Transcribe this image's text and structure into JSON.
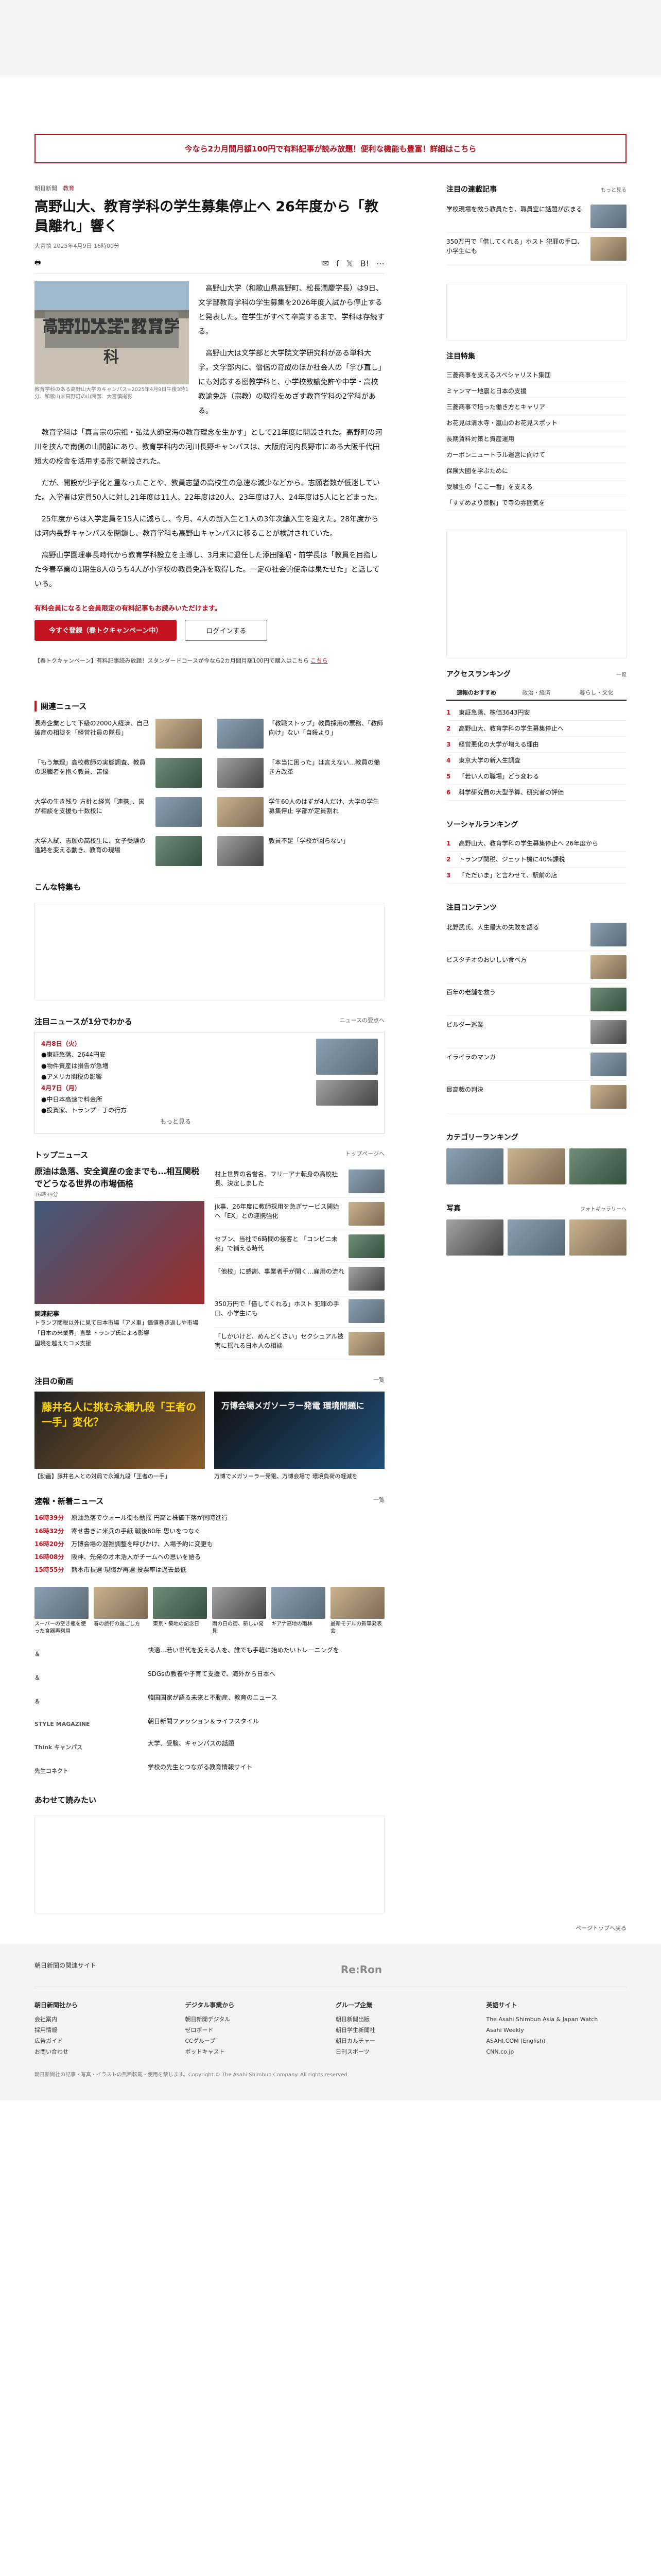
{
  "promo": "今なら2カ月間月額100円で有料記事が読み放題！便利な機能も豊富！詳細はこちら",
  "article": {
    "crumb_section": "朝日新聞",
    "crumb_category": "教育",
    "title": "高野山大、教育学科の学生募集停止へ 26年度から「教員離れ」響く",
    "byline": "大宮慎 2025年4月9日 16時00分",
    "photo_sign": "高野山大学 教育学科",
    "caption": "教育学科のある高野山大学のキャンパス=2025年4月9日午後3時1分、和歌山県高野町の山間部、大宮慎撮影",
    "paragraphs": [
      "高野山大学（和歌山県高野町、松長潤慶学長）は9日、文学部教育学科の学生募集を2026年度入試から停止すると発表した。在学生がすべて卒業するまで、学科は存続する。",
      "高野山大は文学部と大学院文学研究科がある単科大学。文学部内に、僧侶の育成のほか社会人の「学び直し」にも対応する密教学科と、小学校教諭免許や中学・高校教諭免許（宗教）の取得をめざす教育学科の2学科がある。",
      "教育学科は「真言宗の宗祖・弘法大師空海の教育理念を生かす」として21年度に開設された。高野町の河川を挟んで南側の山間部にあり、教育学科内の河川長野キャンパスは、大阪府河内長野市にある大阪千代田短大の校舎を活用する形で新設された。",
      "だが、開設が少子化と重なったことや、教員志望の高校生の急速な減少などから、志願者数が低迷していた。入学者は定員50人に対し21年度は11人、22年度は20人、23年度は7人、24年度は5人にとどまった。",
      "25年度からは入学定員を15人に減らし、今月、4人の新入生と1人の3年次編入生を迎えた。28年度からは河内長野キャンパスを閉鎖し、教育学科も高野山キャンパスに移ることが検討されていた。",
      "高野山学園理事長時代から教育学科設立を主導し、3月末に退任した添田隆昭・前学長は「教員を目指した今春卒業の1期生8人のうち4人が小学校の教員免許を取得した。一定の社会的使命は果たせた」と話している。"
    ],
    "members_note": "有料会員になると会員限定の有料記事もお読みいただけます。",
    "btn_subscribe": "今すぐ登録（春トクキャンペーン中）",
    "btn_login": "ログインする",
    "campaign_text": "【春トクキャンペーン】有料記事読み放題！スタンダードコースが今なら2カ月間月額100円で購入はこちら",
    "campaign_link": "こちら"
  },
  "related": {
    "heading": "関連ニュース",
    "items": [
      "長寿企業として下級の2000人経済、自己破産の相談を「経営社員の隊長」",
      "「教職ストップ」教員採用の票務、「教師向け」ない「自殺より」",
      "「もう無理」高校教師の実態調査、教員の退職者を抱く教員、苦悩",
      "「本当に困った」は言えない…教員の働き方改革",
      "大学の生き残り 方針と経営「連携」、国が相談を支援も十数校に",
      "学生60人のはずが4人だけ、大学の学生募集停止 学部が定員割れ",
      "大学入試、志願の高校生に、女子受験の進路を変える動き、教育の現場",
      "教員不足「学校が回らない」"
    ]
  },
  "special": {
    "heading": "こんな特集も"
  },
  "calendar": {
    "heading": "注目ニュースが1分でわかる",
    "link": "ニュースの要点へ",
    "day1": "4月8日（火）",
    "day1_items": [
      "●東証急落、2644円安",
      "●物件資産は損告が急増",
      "●アメリカ関税の影響"
    ],
    "day2": "4月7日（月）",
    "day2_items": [
      "●中日本高速で料金所",
      "●投資家、トランプ一丁の行方"
    ],
    "more": "もっと見る"
  },
  "topnews": {
    "heading": "トップニュース",
    "link": "トップページへ",
    "lead_title": "原油は急落、安全資産の金までも…相互関税でどうなる世界の市場価格",
    "lead_time": "16時39分",
    "sub_title": "関連記事",
    "sub_items": [
      "トランプ関税以外に見て日本市場「アメ車」価値巻き返しや市場",
      "「日本の米業界」直撃 トランプ氏による影響",
      "国境を越えたコメ支援"
    ],
    "items": [
      "村上世界の名誉名、フリーアナ転身の高校社長、決定しました",
      "jk事、26年度に教師採用を急ぎサービス開始へ「EX」との連携強化",
      "セブン、当社で6時間の接客と 「コンビニ未来」で補える時代",
      "「他校」に感謝、事業者手が開く…雇用の流れ",
      "350万円で「借してくれる」ホスト 犯罪の手口、小学生にも",
      "「しかいけど、めんどくさい」セクシュアル被害に揺れる日本人の相談"
    ]
  },
  "video": {
    "heading": "注目の動画",
    "link": "一覧",
    "v1": "藤井名人に挑む永瀬九段「王者の一手」変化？",
    "v2": "万博会場メガソーラー発電 環境問題に",
    "cap1": "【動画】藤井名人との対局で永瀬九段「王者の一手」",
    "cap2": "万博でメガソーラー発電、万博会場で 環境負荷の軽減を"
  },
  "flash": {
    "heading": "速報・新着ニュース",
    "link": "一覧",
    "items": [
      {
        "t": "16時39分",
        "s": "原油急落でウォール街も動揺 円高と株価下落が同時進行"
      },
      {
        "t": "16時32分",
        "s": "寄せ書きに米兵の手紙 戦後80年 思いをつなぐ"
      },
      {
        "t": "16時20分",
        "s": "万博会場の混雑調整を呼びかけ、入場予約に変更も"
      },
      {
        "t": "16時08分",
        "s": "阪神、先発の才木浩人がチームへの思いを語る"
      },
      {
        "t": "15時55分",
        "s": "熊本市長選 現職が再選 投票率は過去最低"
      }
    ]
  },
  "pictures": [
    "スーパーの空き瓶を使った食器再利用",
    "春の旅行の過ごし方",
    "東京・築地の記念日",
    "雨の日の街、新しい発見",
    "ギアナ高地の雨林",
    "最新モデルの新車発表会"
  ],
  "brands": [
    {
      "logo": "＆",
      "txt": "快適…若い世代を変える人を、誰でも手軽に始めたいトレーニングを"
    },
    {
      "logo": "＆",
      "txt": "SDGsの教養や子育て支援で、海外から日本へ"
    },
    {
      "logo": "＆",
      "txt": "韓国国家が語る未来と不動産、教育のニュース"
    },
    {
      "logo": "STYLE MAGAZINE",
      "txt": "朝日新聞ファッション＆ライフスタイル"
    },
    {
      "logo": "Think キャンパス",
      "txt": "大学、受験、キャンパスの話題"
    },
    {
      "logo": "先生コネクト",
      "txt": "学校の先生とつながる教育情報サイト"
    }
  ],
  "try_heading": "あわせて読みたい",
  "side": {
    "today_heading": "注目の連載記事",
    "today_link": "もっと見る",
    "today_items": [
      "学校現場を救う教員たち、職員室に話題が広まる",
      "350万円で「借してくれる」ホスト 犯罪の手口、小学生にも"
    ],
    "feature_heading": "注目特集",
    "feature_items": [
      "三菱商事を支えるスペシャリスト集団",
      "ミャンマー地震と日本の支援",
      "三菱商事で培った働き方とキャリア",
      "お花見は清水寺・嵐山のお花見スポット",
      "長期賃料対策と資産運用",
      "カーボンニュートラル運営に向けて",
      "保険大國を学ぶために",
      "受験生の「ここ一番」を支える",
      "「すずめより景観」で寺の雰囲気を"
    ],
    "access_heading": "アクセスランキング",
    "access_link": "一覧",
    "tabs": [
      "速報のおすすめ",
      "政治・経済",
      "暮らし・文化"
    ],
    "access_items": [
      "東証急落、株価3643円安",
      "高野山大、教育学科の学生募集停止へ",
      "経営悪化の大学が増える理由",
      "東京大学の新入生調査",
      "「若い人の職場」どう変わる",
      "科学研究費の大型予算、研究者の評価"
    ],
    "social_heading": "ソーシャルランキング",
    "social_items": [
      "高野山大、教育学科の学生募集停止へ 26年度から",
      "トランプ関税、ジェット機に40%課税",
      "「ただいま」と言わせて、駅前の店"
    ],
    "contents_heading": "注目コンテンツ",
    "contents_items": [
      "北野武氏、人生最大の失敗を語る",
      "ピスタチオのおいしい食べ方",
      "百年の老舗を救う",
      "ビルダー巡業",
      "イライラのマンガ",
      "最高裁の判決"
    ],
    "ranking_heading": "カテゴリーランキング",
    "photo_heading": "写真",
    "photo_link": "フォトギャラリーへ"
  },
  "pager": "ページトップへ戻る",
  "footer": {
    "name": "朝日新聞の関連サイト",
    "logo": "Re:Ron",
    "cols": [
      {
        "h": "朝日新聞社から",
        "items": [
          "会社案内",
          "採用情報",
          "広告ガイド",
          "お問い合わせ"
        ]
      },
      {
        "h": "デジタル事業から",
        "items": [
          "朝日新聞デジタル",
          "ゼロボード",
          "CCグループ",
          "ポッドキャスト"
        ]
      },
      {
        "h": "グループ企業",
        "items": [
          "朝日新聞出版",
          "朝日学生新聞社",
          "朝日カルチャー",
          "日刊スポーツ"
        ]
      },
      {
        "h": "英語サイト",
        "items": [
          "The Asahi Shimbun Asia & Japan Watch",
          "Asahi Weekly",
          "ASAHI.COM (English)",
          "CNN.co.jp"
        ]
      }
    ],
    "copy": "朝日新聞社の記事・写真・イラストの無断転載・使用を禁じます。Copyright © The Asahi Shimbun Company. All rights reserved."
  }
}
